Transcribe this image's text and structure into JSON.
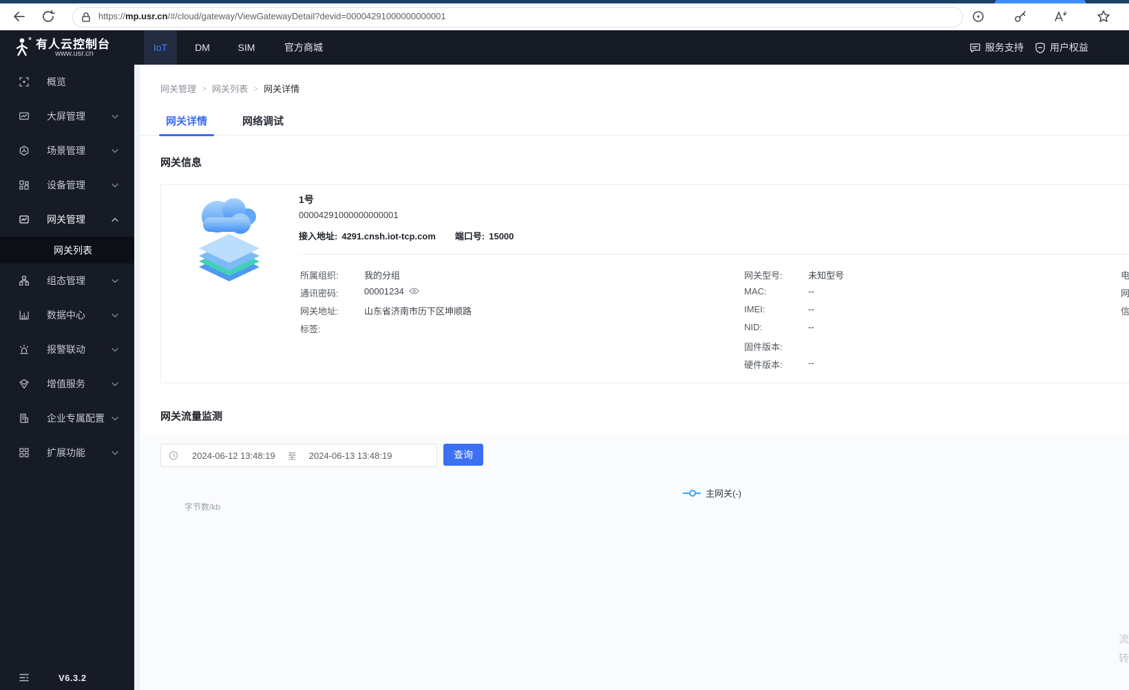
{
  "browser": {
    "url_scheme": "https://",
    "url_host": "mp.usr.cn",
    "url_rest": "/#/cloud/gateway/ViewGatewayDetail?devid=00004291000000000001"
  },
  "navbar": {
    "logo_title": "有人云控制台",
    "logo_subtitle": "www.usr.cn",
    "tabs": [
      {
        "label": "IoT"
      },
      {
        "label": "DM"
      },
      {
        "label": "SIM"
      },
      {
        "label": "官方商城"
      }
    ],
    "support_label": "服务支持",
    "rights_label": "用户权益"
  },
  "sidebar": {
    "items": [
      {
        "label": "概览"
      },
      {
        "label": "大屏管理"
      },
      {
        "label": "场景管理"
      },
      {
        "label": "设备管理"
      },
      {
        "label": "网关管理"
      },
      {
        "label": "组态管理"
      },
      {
        "label": "数据中心"
      },
      {
        "label": "报警联动"
      },
      {
        "label": "增值服务"
      },
      {
        "label": "企业专属配置"
      },
      {
        "label": "扩展功能"
      }
    ],
    "sub_item": {
      "label": "网关列表"
    },
    "version": "V6.3.2"
  },
  "breadcrumb": {
    "separator": ">",
    "items": [
      {
        "label": "网关管理"
      },
      {
        "label": "网关列表"
      },
      {
        "label": "网关详情"
      }
    ]
  },
  "page_tabs": [
    {
      "label": "网关详情"
    },
    {
      "label": "网络调试"
    }
  ],
  "gateway_info": {
    "section_title": "网关信息",
    "name": "1号",
    "device_id": "00004291000000000001",
    "access_label": "接入地址:",
    "access_value": "4291.cnsh.iot-tcp.com",
    "port_label": "端口号:",
    "port_value": "15000",
    "details_left": [
      {
        "label": "所属组织:",
        "value": "我的分组"
      },
      {
        "label": "通讯密码:",
        "value": "00001234"
      },
      {
        "label": "网关地址:",
        "value": "山东省济南市历下区坤顺路"
      },
      {
        "label": "标签:",
        "value": ""
      }
    ],
    "details_right": [
      {
        "label": "网关型号:",
        "value": "未知型号"
      },
      {
        "label": "MAC:",
        "value": "--"
      },
      {
        "label": "IMEI:",
        "value": "--"
      },
      {
        "label": "NID:",
        "value": "--"
      },
      {
        "label": "固件版本:",
        "value": ""
      },
      {
        "label": "硬件版本:",
        "value": "--"
      }
    ],
    "details_clipped": [
      {
        "label": "电"
      },
      {
        "label": "网"
      },
      {
        "label": "信"
      }
    ]
  },
  "traffic": {
    "section_title": "网关流量监测",
    "date_from": "2024-06-12 13:48:19",
    "date_separator": "至",
    "date_to": "2024-06-13 13:48:19",
    "query_label": "查询",
    "chart": {
      "type": "line",
      "legend": "主网关(-)",
      "ylabel": "字节数/kb",
      "series_color": "#3aa1f8",
      "points": []
    }
  },
  "floating_clipped": [
    {
      "label": "流"
    },
    {
      "label": "转"
    }
  ],
  "colors": {
    "accent_blue": "#3a6cf2",
    "legend_blue": "#3aa1f8",
    "dark_bg": "#171b26"
  }
}
